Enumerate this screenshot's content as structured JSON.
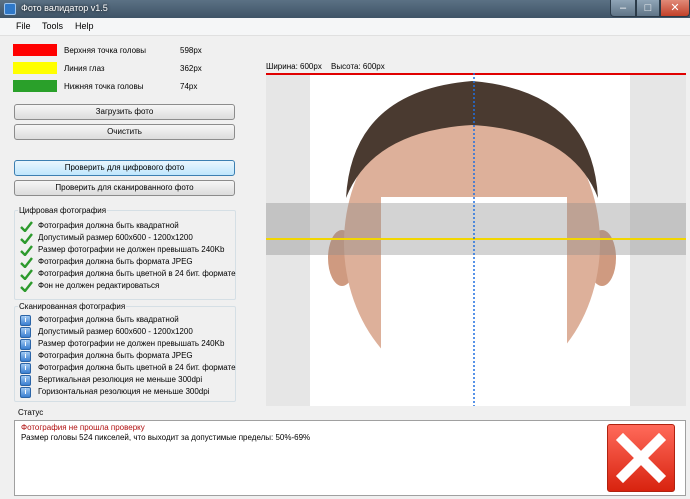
{
  "window": {
    "title": "Фото валидатор v1.5",
    "controls": {
      "minimize": "–",
      "maximize": "□",
      "close": "✕"
    }
  },
  "menu": [
    "File",
    "Tools",
    "Help"
  ],
  "legend": [
    {
      "color": "#ff0000",
      "label": "Верхняя точка головы",
      "value": "598px"
    },
    {
      "color": "#ffff00",
      "label": "Линия глаз",
      "value": "362px"
    },
    {
      "color": "#2aa02a",
      "label": "Нижняя точка головы",
      "value": "74px"
    }
  ],
  "buttons": {
    "load": "Загрузить фото",
    "clear": "Очистить",
    "check_digital": "Проверить для цифрового фото",
    "check_scanned": "Проверить для сканированного фото"
  },
  "digital_group": {
    "title": "Цифровая фотография",
    "items": [
      "Фотография должна быть квадратной",
      "Допустимый размер 600x600 - 1200x1200",
      "Размер фотографии не должен превышать 240Kb",
      "Фотография должна быть формата JPEG",
      "Фотография должна быть цветной в 24 бит. формате",
      "Фон не должен редактироваться"
    ]
  },
  "scanned_group": {
    "title": "Сканированная фотография",
    "items": [
      "Фотография должна быть квадратной",
      "Допустимый размер 600x600 - 1200x1200",
      "Размер фотографии не должен превышать 240Kb",
      "Фотография должна быть формата JPEG",
      "Фотография должна быть цветной в 24 бит. формате",
      "Вертикальная резолюция не меньше 300dpi",
      "Горизонтальная резолюция не меньше 300dpi"
    ]
  },
  "image_info": {
    "width": "Ширина: 600px",
    "height": "Высота: 600px"
  },
  "status": {
    "title": "Статус",
    "message": "Фотография не прошла проверку",
    "details": "Размер головы 524 пикселей, что выходит за допустимые пределы: 50%-69%"
  },
  "icons": {
    "passed": "green-check-icon",
    "info": "info-icon",
    "result": "fail-x-icon"
  },
  "colors": {
    "failure_text": "#b01010",
    "passed": "#2d9a2d",
    "fail_icon": "#d8230f",
    "center_line": "#1f6fe0"
  }
}
